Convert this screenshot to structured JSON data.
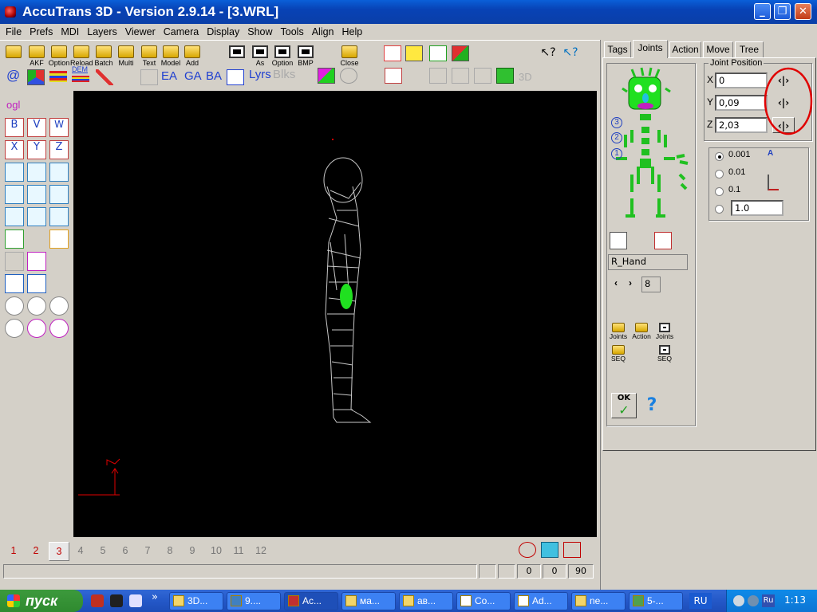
{
  "window": {
    "title": "AccuTrans 3D - Version 2.9.14 - [3.WRL]",
    "minimize_label": "_",
    "maximize_label": "❐",
    "close_label": "✕"
  },
  "menu": [
    "File",
    "Prefs",
    "MDI",
    "Layers",
    "Viewer",
    "Camera",
    "Display",
    "Show",
    "Tools",
    "Align",
    "Help"
  ],
  "toolbar": {
    "row1": [
      "AKF",
      "Option",
      "Reload",
      "Batch",
      "Multi",
      "Text",
      "Model",
      "Add",
      "As",
      "Option",
      "BMP",
      "Close"
    ],
    "row2_text": [
      "EA",
      "GA",
      "BA",
      "Lyrs",
      "Blks"
    ],
    "at_symbol": "@",
    "dem_label": "DEM",
    "view3d_label": "3D",
    "help_glyphs": "?",
    "help_arrow_glyphs": "↖?"
  },
  "left_tools": {
    "ogl_label": "ogl",
    "row_bvw": [
      "B",
      "V",
      "W"
    ],
    "row_xyz": [
      "X",
      "Y",
      "Z"
    ]
  },
  "pages": {
    "items": [
      "1",
      "2",
      "3",
      "4",
      "5",
      "6",
      "7",
      "8",
      "9",
      "10",
      "11",
      "12"
    ],
    "active": "3"
  },
  "status": {
    "values": [
      "0",
      "0",
      "90"
    ]
  },
  "right_panel": {
    "tabs": [
      "Tags",
      "Joints",
      "Action",
      "Move",
      "Tree"
    ],
    "active_tab": "Joints",
    "joint_position": {
      "title": "Joint Position",
      "x_label": "X",
      "x_value": "0",
      "y_label": "Y",
      "y_value": "0,09",
      "z_label": "Z",
      "z_value": "2,03",
      "arrow_label": "‹|›"
    },
    "steps": [
      "0.001",
      "0.01",
      "0.1"
    ],
    "custom_step": "1.0",
    "level_markers": [
      "3",
      "2",
      "1"
    ],
    "joint_name": "R_Hand",
    "index_prev": "‹",
    "index_next": "›",
    "index_value": "8",
    "file_buttons": [
      {
        "label": "Joints"
      },
      {
        "label": "Action"
      },
      {
        "label": "Joints"
      },
      {
        "label": "SEQ"
      },
      {
        "label": "SEQ"
      }
    ],
    "ok_label": "OK",
    "help_label": "?",
    "step_icon_letter": "A"
  },
  "taskbar": {
    "start_label": "пуск",
    "tasks": [
      "3D...",
      "9....",
      "Ac...",
      "ма...",
      "ав...",
      "Co...",
      "Ad...",
      "ne...",
      "5-..."
    ],
    "lang": "RU",
    "tray_lang": "Ru",
    "time": "1:13",
    "quick_more": "»"
  }
}
